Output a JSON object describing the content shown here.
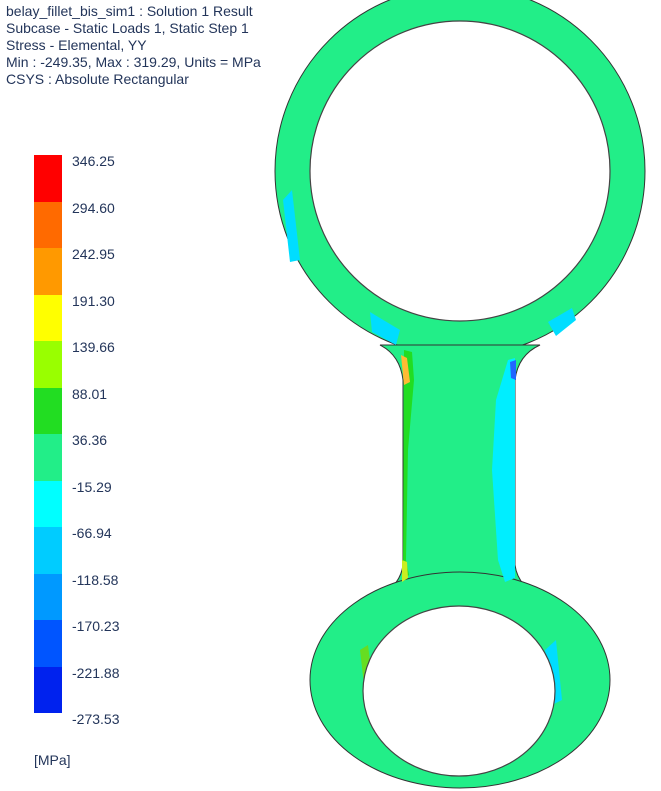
{
  "header": {
    "line1": "belay_fillet_bis_sim1 : Solution 1 Result",
    "line2": "Subcase - Static Loads 1, Static Step 1",
    "line3": "Stress - Elemental, YY",
    "line4": "Min : -249.35, Max : 319.29, Units = MPa",
    "line5": "CSYS : Absolute Rectangular"
  },
  "legend": {
    "labels": [
      "346.25",
      "294.60",
      "242.95",
      "191.30",
      "139.66",
      "88.01",
      "36.36",
      "-15.29",
      "-66.94",
      "-118.58",
      "-170.23",
      "-221.88",
      "-273.53"
    ],
    "colors": [
      "#ff0000",
      "#ff6a00",
      "#ff9900",
      "#ffff00",
      "#99ff00",
      "#22dd22",
      "#22ee88",
      "#00ffff",
      "#00ccff",
      "#0099ff",
      "#0055ff",
      "#0022ee",
      "#0000ff"
    ],
    "units": "[MPa]"
  },
  "model": {
    "base_color": "#22ee88",
    "outline_color": "#333333"
  }
}
